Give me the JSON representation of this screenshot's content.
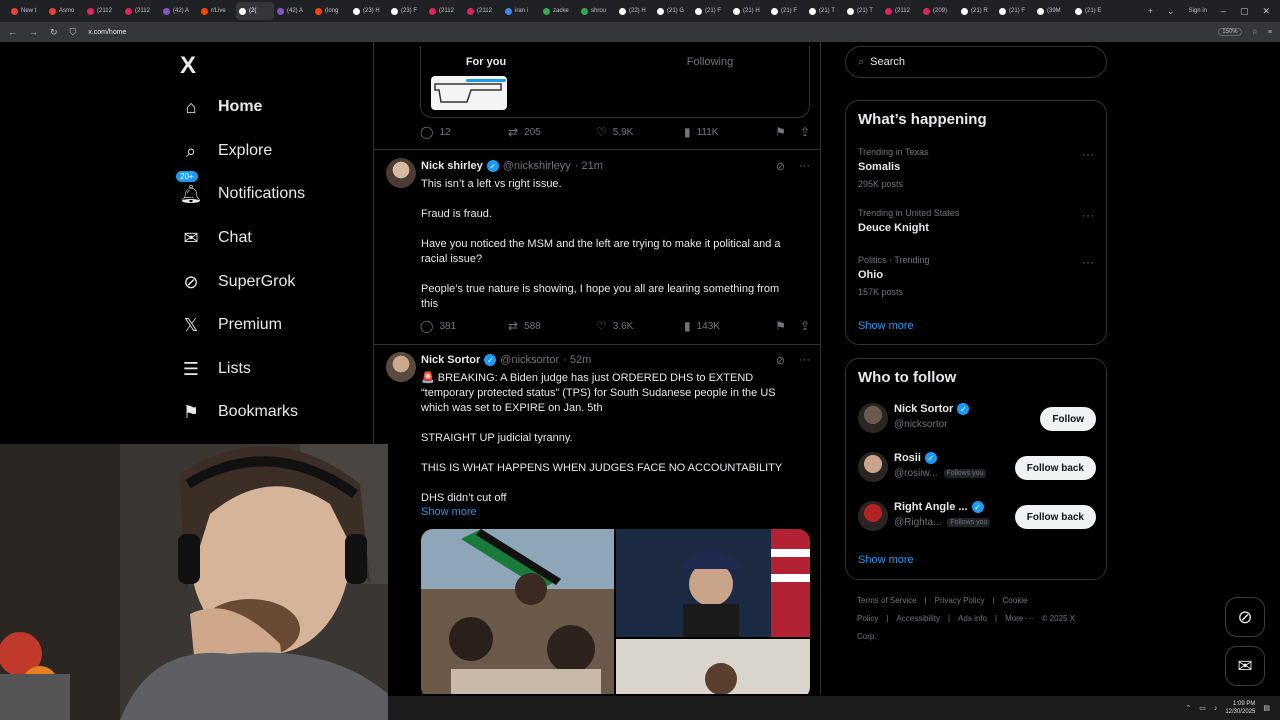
{
  "browser": {
    "tabs": [
      {
        "label": "New t",
        "color": "#ea4335"
      },
      {
        "label": "Asmo",
        "color": "#ea4335"
      },
      {
        "label": "(2112",
        "color": "#e0245e"
      },
      {
        "label": "(2112",
        "color": "#e0245e"
      },
      {
        "label": "(42) A",
        "color": "#7e57c2"
      },
      {
        "label": "r/Live",
        "color": "#ff4500"
      },
      {
        "label": "(2(",
        "color": "#ffffff",
        "active": true
      },
      {
        "label": "(42) A",
        "color": "#7e57c2"
      },
      {
        "label": "(long",
        "color": "#ff4500"
      },
      {
        "label": "(23) H",
        "color": "#ffffff"
      },
      {
        "label": "(23) F",
        "color": "#ffffff"
      },
      {
        "label": "(2112",
        "color": "#e0245e"
      },
      {
        "label": "(2112",
        "color": "#e0245e"
      },
      {
        "label": "iran i",
        "color": "#4285f4"
      },
      {
        "label": "zacke",
        "color": "#34a853"
      },
      {
        "label": "shrou",
        "color": "#34a853"
      },
      {
        "label": "(22) H",
        "color": "#ffffff"
      },
      {
        "label": "(21) G",
        "color": "#ffffff"
      },
      {
        "label": "(21) F",
        "color": "#ffffff"
      },
      {
        "label": "(21) H",
        "color": "#ffffff"
      },
      {
        "label": "(21) F",
        "color": "#ffffff"
      },
      {
        "label": "(21) T",
        "color": "#ffffff"
      },
      {
        "label": "(21) T",
        "color": "#ffffff"
      },
      {
        "label": "(2112",
        "color": "#e0245e"
      },
      {
        "label": "(209)",
        "color": "#e0245e"
      },
      {
        "label": "(21) R",
        "color": "#ffffff"
      },
      {
        "label": "(21) F",
        "color": "#ffffff"
      },
      {
        "label": "(39M",
        "color": "#ffffff"
      },
      {
        "label": "(21) E",
        "color": "#ffffff"
      }
    ],
    "url": "x.com/home",
    "zoom": "150%",
    "sign_in": "Sign in"
  },
  "nav": {
    "logo": "X",
    "items": [
      {
        "label": "Home",
        "icon": "home-icon",
        "glyph": "⌂"
      },
      {
        "label": "Explore",
        "icon": "search-icon",
        "glyph": "⌕"
      },
      {
        "label": "Notifications",
        "icon": "bell-icon",
        "glyph": "🔔︎",
        "badge": "20+"
      },
      {
        "label": "Chat",
        "icon": "mail-icon",
        "glyph": "✉"
      },
      {
        "label": "SuperGrok",
        "icon": "grok-icon",
        "glyph": "⊘"
      },
      {
        "label": "Premium",
        "icon": "x-icon",
        "glyph": "𝕏"
      },
      {
        "label": "Lists",
        "icon": "list-icon",
        "glyph": "☰"
      },
      {
        "label": "Bookmarks",
        "icon": "bookmark-icon",
        "glyph": "⚑"
      }
    ]
  },
  "feed": {
    "tabs": [
      "For you",
      "Following"
    ],
    "prev_stats": {
      "replies": "12",
      "reposts": "205",
      "likes": "5.9K",
      "views": "111K"
    },
    "posts": [
      {
        "name": "Nick shirley",
        "handle": "@nickshirleyy",
        "time": "· 21m",
        "lines": [
          "This isn’t a left vs right issue.",
          "Fraud is fraud.",
          "Have you noticed the MSM and the left are trying to make it political and a",
          "racial issue?",
          "People’s true nature is showing, I hope you all are learing something from",
          "this"
        ],
        "stats": {
          "replies": "381",
          "reposts": "588",
          "likes": "3.6K",
          "views": "143K"
        }
      },
      {
        "name": "Nick Sortor",
        "handle": "@nicksortor",
        "time": "· 52m",
        "lines": [
          "🚨 BREAKING: A Biden judge has just ORDERED DHS to EXTEND",
          "“temporary protected status” (TPS) for South Sudanese people in the US",
          "which was set to EXPIRE on Jan. 5th",
          "STRAIGHT UP judicial tyranny.",
          "THIS IS WHAT HAPPENS WHEN JUDGES FACE NO ACCOUNTABILITY",
          "DHS didn’t cut off"
        ],
        "show_more": "Show more"
      }
    ]
  },
  "sidebar": {
    "search_placeholder": "Search",
    "happening": {
      "title": "What’s happening",
      "trends": [
        {
          "meta": "Trending in Texas",
          "name": "Somalis",
          "count": "295K posts"
        },
        {
          "meta": "Trending in United States",
          "name": "Deuce Knight",
          "count": ""
        },
        {
          "meta": "Politics · Trending",
          "name": "Ohio",
          "count": "157K posts"
        }
      ],
      "show_more": "Show more"
    },
    "who_to_follow": {
      "title": "Who to follow",
      "accounts": [
        {
          "name": "Nick Sortor",
          "handle": "@nicksortor",
          "follows_you": "",
          "button": "Follow",
          "av": "#6b5a4e"
        },
        {
          "name": "Rosii",
          "handle": "@rosiiw...",
          "follows_you": "Follows you",
          "button": "Follow back",
          "av": "#c9a48a"
        },
        {
          "name": "Right Angle ...",
          "handle": "@Righta...",
          "follows_you": "Follows you",
          "button": "Follow back",
          "av": "#b22222"
        }
      ],
      "show_more": "Show more"
    },
    "footer": [
      "Terms of Service",
      "|",
      "Privacy Policy",
      "|",
      "Cookie Policy",
      "|",
      "Accessibility",
      "|",
      "Ads info",
      "|",
      "More ···",
      "© 2025 X Corp."
    ]
  },
  "taskbar": {
    "time": "1:09 PM",
    "date": "12/30/2025"
  }
}
